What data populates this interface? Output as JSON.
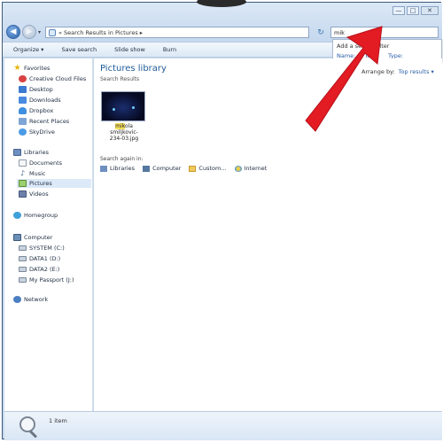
{
  "window": {
    "address": "« Search Results in Pictures ▸",
    "search_query": "mik",
    "buttons": {
      "minimize": "—",
      "maximize": "□",
      "close": "✕"
    }
  },
  "toolbar": {
    "items": [
      "Organize ▾",
      "Save search",
      "Slide show",
      "Burn"
    ]
  },
  "suggestions": {
    "title": "Add a search filter",
    "filters": [
      "Name:",
      "Tags:",
      "Type:"
    ]
  },
  "nav": {
    "favorites_label": "Favorites",
    "favorites": [
      "Creative Cloud Files",
      "Desktop",
      "Downloads",
      "Dropbox",
      "Recent Places",
      "SkyDrive"
    ],
    "libraries_label": "Libraries",
    "libraries": [
      "Documents",
      "Music",
      "Pictures",
      "Videos"
    ],
    "homegroup_label": "Homegroup",
    "computer_label": "Computer",
    "drives": [
      "SYSTEM (C:)",
      "DATA1 (D:)",
      "DATA2 (E:)",
      "My Passport (J:)"
    ],
    "network_label": "Network"
  },
  "content": {
    "title": "Pictures library",
    "subtitle": "Search Results",
    "arrange_label": "Arrange by:",
    "arrange_value": "Top results ▾",
    "file": {
      "name_highlight": "mik",
      "name_rest_line1": "ola",
      "name_line2": "smiljkovic-",
      "name_line3": "234-03.jpg"
    },
    "search_again_title": "Search again in:",
    "search_again": [
      "Libraries",
      "Computer",
      "Custom...",
      "Internet"
    ]
  },
  "details": {
    "item_count": "1 item"
  },
  "colors": {
    "arrow": "#e31b23",
    "library_title": "#1f5c99",
    "frame": "#c7d9ee"
  }
}
